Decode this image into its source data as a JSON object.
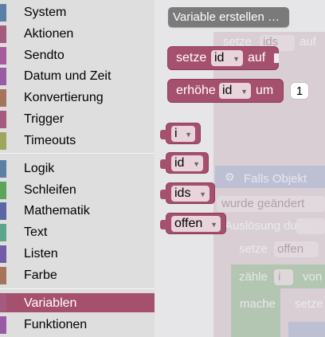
{
  "toolbox": {
    "categories": [
      {
        "label": "System",
        "color": "#5b80a5"
      },
      {
        "label": "Aktionen",
        "color": "#a55b80"
      },
      {
        "label": "Sendto",
        "color": "#a55b9e"
      },
      {
        "label": "Datum und Zeit",
        "color": "#9a5ba5"
      },
      {
        "label": "Konvertierung",
        "color": "#a5745b"
      },
      {
        "label": "Trigger",
        "color": "#a55b80"
      },
      {
        "label": "Timeouts",
        "color": "#9fa55b"
      },
      {
        "label": "Logik",
        "color": "#5b80a5"
      },
      {
        "label": "Schleifen",
        "color": "#5ba55b"
      },
      {
        "label": "Mathematik",
        "color": "#5b67a5"
      },
      {
        "label": "Text",
        "color": "#5ba58c"
      },
      {
        "label": "Listen",
        "color": "#745ba5"
      },
      {
        "label": "Farbe",
        "color": "#a5745b"
      },
      {
        "label": "Variablen",
        "color": "#a55b80"
      },
      {
        "label": "Funktionen",
        "color": "#995ba5"
      }
    ],
    "selected": "Variablen"
  },
  "flyout": {
    "create_button": "Variable erstellen …",
    "set_block": {
      "label": "setze",
      "var": "id",
      "suffix": "auf"
    },
    "change_block": {
      "label": "erhöhe",
      "var": "id",
      "suffix": "um",
      "value": "1"
    },
    "getters": [
      "i",
      "id",
      "ids",
      "offen"
    ]
  },
  "workspace": {
    "bg_texts": {
      "set_top": "setze",
      "set_top_var": "ids",
      "set_top_suffix": "auf",
      "if_object": "Falls Objekt",
      "changed": "wurde geändert",
      "trigger": "Auslösung durch",
      "set_open": "setze",
      "set_open_var": "offen",
      "count": "zähle",
      "count_var": "i",
      "count_suffix": "von",
      "do": "mache",
      "set_inner": "setze"
    }
  },
  "colors": {
    "variables": "#a5506d",
    "button": "#7a7a7a"
  }
}
